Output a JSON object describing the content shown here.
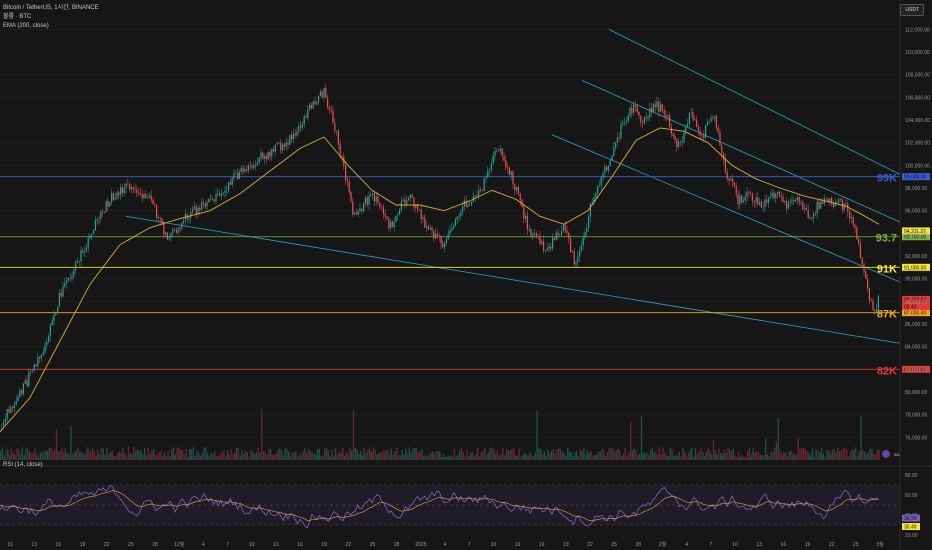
{
  "header": {
    "symbol_line": "Bitcoin / TetherUS, 1시간, BINANCE",
    "volume_label": "볼륨 · BTC",
    "ema_label": "EMA (200, close)",
    "rsi_label": "RSI (14, close)",
    "currency_button": "USDT"
  },
  "chart_data": {
    "type": "candlestick",
    "symbol": "BTC/USDT",
    "interval": "1h",
    "exchange": "BINANCE",
    "ylim": [
      74000,
      113000
    ],
    "y_ticks": [
      76000,
      78000,
      80000,
      82000,
      84000,
      86000,
      88000,
      90000,
      92000,
      94000,
      96000,
      98000,
      100000,
      102000,
      104000,
      106000,
      108000,
      110000,
      112000
    ],
    "y_tick_labels": [
      "76,000.00",
      "78,000.00",
      "80,000.00",
      "82,000.00",
      "84,000.00",
      "86,000.00",
      "88,000.00",
      "90,000.00",
      "92,000.00",
      "94,000.00",
      "96,000.00",
      "98,000.00",
      "100,000.00",
      "102,000.00",
      "104,000.00",
      "106,000.00",
      "108,000.00",
      "110,000.00",
      "112,000.00"
    ],
    "x_tick_labels": [
      "10",
      "13",
      "16",
      "19",
      "22",
      "25",
      "28",
      "12월",
      "4",
      "7",
      "10",
      "13",
      "16",
      "19",
      "22",
      "25",
      "28",
      "2025",
      "4",
      "7",
      "10",
      "13",
      "16",
      "19",
      "22",
      "25",
      "28",
      "2월",
      "4",
      "7",
      "10",
      "13",
      "16",
      "19",
      "22",
      "25",
      "3월"
    ],
    "price_path": [
      {
        "x": 0,
        "y": 77000
      },
      {
        "x": 8,
        "y": 80500
      },
      {
        "x": 14,
        "y": 83500
      },
      {
        "x": 20,
        "y": 88500
      },
      {
        "x": 26,
        "y": 91500
      },
      {
        "x": 32,
        "y": 95000
      },
      {
        "x": 38,
        "y": 97500
      },
      {
        "x": 44,
        "y": 98200
      },
      {
        "x": 50,
        "y": 97000
      },
      {
        "x": 56,
        "y": 93500
      },
      {
        "x": 62,
        "y": 95500
      },
      {
        "x": 68,
        "y": 96500
      },
      {
        "x": 74,
        "y": 97500
      },
      {
        "x": 80,
        "y": 99500
      },
      {
        "x": 86,
        "y": 100500
      },
      {
        "x": 92,
        "y": 101500
      },
      {
        "x": 98,
        "y": 102500
      },
      {
        "x": 104,
        "y": 105500
      },
      {
        "x": 108,
        "y": 106500
      },
      {
        "x": 112,
        "y": 103000
      },
      {
        "x": 118,
        "y": 95500
      },
      {
        "x": 124,
        "y": 97500
      },
      {
        "x": 130,
        "y": 94500
      },
      {
        "x": 136,
        "y": 97500
      },
      {
        "x": 142,
        "y": 94500
      },
      {
        "x": 148,
        "y": 93000
      },
      {
        "x": 154,
        "y": 96500
      },
      {
        "x": 160,
        "y": 97500
      },
      {
        "x": 166,
        "y": 101500
      },
      {
        "x": 170,
        "y": 99500
      },
      {
        "x": 176,
        "y": 94500
      },
      {
        "x": 182,
        "y": 92500
      },
      {
        "x": 188,
        "y": 94500
      },
      {
        "x": 192,
        "y": 91000
      },
      {
        "x": 198,
        "y": 97500
      },
      {
        "x": 204,
        "y": 101000
      },
      {
        "x": 208,
        "y": 104000
      },
      {
        "x": 212,
        "y": 105500
      },
      {
        "x": 214,
        "y": 103500
      },
      {
        "x": 218,
        "y": 105500
      },
      {
        "x": 222,
        "y": 104500
      },
      {
        "x": 226,
        "y": 101500
      },
      {
        "x": 230,
        "y": 104500
      },
      {
        "x": 234,
        "y": 102500
      },
      {
        "x": 238,
        "y": 104500
      },
      {
        "x": 242,
        "y": 99500
      },
      {
        "x": 246,
        "y": 97000
      },
      {
        "x": 250,
        "y": 97500
      },
      {
        "x": 254,
        "y": 96500
      },
      {
        "x": 258,
        "y": 97500
      },
      {
        "x": 262,
        "y": 96500
      },
      {
        "x": 266,
        "y": 97000
      },
      {
        "x": 270,
        "y": 95500
      },
      {
        "x": 274,
        "y": 97000
      },
      {
        "x": 278,
        "y": 96800
      },
      {
        "x": 282,
        "y": 96300
      },
      {
        "x": 285,
        "y": 94500
      },
      {
        "x": 287,
        "y": 91500
      },
      {
        "x": 289,
        "y": 89500
      },
      {
        "x": 291,
        "y": 87000
      },
      {
        "x": 293,
        "y": 88200
      }
    ],
    "ema_200": [
      {
        "x": 0,
        "y": 76500
      },
      {
        "x": 10,
        "y": 79500
      },
      {
        "x": 20,
        "y": 84500
      },
      {
        "x": 30,
        "y": 89500
      },
      {
        "x": 40,
        "y": 93000
      },
      {
        "x": 50,
        "y": 94500
      },
      {
        "x": 60,
        "y": 95300
      },
      {
        "x": 70,
        "y": 96000
      },
      {
        "x": 80,
        "y": 97500
      },
      {
        "x": 90,
        "y": 99500
      },
      {
        "x": 100,
        "y": 101500
      },
      {
        "x": 108,
        "y": 102500
      },
      {
        "x": 116,
        "y": 100000
      },
      {
        "x": 124,
        "y": 97800
      },
      {
        "x": 132,
        "y": 96500
      },
      {
        "x": 140,
        "y": 96500
      },
      {
        "x": 148,
        "y": 96000
      },
      {
        "x": 156,
        "y": 96800
      },
      {
        "x": 164,
        "y": 97800
      },
      {
        "x": 172,
        "y": 97000
      },
      {
        "x": 180,
        "y": 95500
      },
      {
        "x": 188,
        "y": 94800
      },
      {
        "x": 196,
        "y": 96000
      },
      {
        "x": 204,
        "y": 99000
      },
      {
        "x": 212,
        "y": 102200
      },
      {
        "x": 220,
        "y": 103300
      },
      {
        "x": 228,
        "y": 103000
      },
      {
        "x": 236,
        "y": 102000
      },
      {
        "x": 244,
        "y": 100000
      },
      {
        "x": 252,
        "y": 98800
      },
      {
        "x": 260,
        "y": 98000
      },
      {
        "x": 268,
        "y": 97300
      },
      {
        "x": 276,
        "y": 96800
      },
      {
        "x": 282,
        "y": 96400
      },
      {
        "x": 287,
        "y": 95700
      },
      {
        "x": 293,
        "y": 94800
      }
    ],
    "horizontal_levels": [
      {
        "label": "99K",
        "value": 99000,
        "tag": "99,000.00",
        "color": "#3b5bdb"
      },
      {
        "label": "93.7",
        "value": 93700,
        "tag": "93,700.00",
        "color": "#7cb342"
      },
      {
        "label": "91K",
        "value": 91000,
        "tag": "91,000.00",
        "color": "#f5e63a"
      },
      {
        "label": "87K",
        "value": 87000,
        "tag": "87,000.00",
        "color": "#f5a623"
      },
      {
        "label": "82K",
        "value": 82000,
        "tag": "82,000.00",
        "color": "#e53935"
      }
    ],
    "price_tags": [
      {
        "value": 94211.27,
        "text": "94,211.27",
        "color": "#f5e63a"
      },
      {
        "value": 88168.5,
        "text": "88,168.50",
        "color": "#e53935"
      },
      {
        "value": 88168.5,
        "text": "05:40",
        "color": "#e53935"
      }
    ],
    "trend_lines": [
      {
        "name": "channel-top",
        "from": {
          "x": 203,
          "y": 112000
        },
        "to": {
          "x": 300,
          "y": 99200
        }
      },
      {
        "name": "channel-mid-1",
        "from": {
          "x": 194,
          "y": 107500
        },
        "to": {
          "x": 300,
          "y": 95000
        }
      },
      {
        "name": "channel-mid-2",
        "from": {
          "x": 184,
          "y": 102700
        },
        "to": {
          "x": 300,
          "y": 89700
        }
      },
      {
        "name": "long-support",
        "from": {
          "x": 42,
          "y": 95500
        },
        "to": {
          "x": 300,
          "y": 84300
        }
      }
    ],
    "volume": {
      "badge": "566",
      "x_range": [
        0,
        293
      ]
    },
    "rsi": {
      "ylim": [
        15,
        85
      ],
      "y_ticks": [
        20,
        40,
        60,
        80
      ],
      "y_tick_labels": [
        "20.00",
        "40.00",
        "60.00",
        "80.00"
      ],
      "upper_band": 70,
      "lower_band": 30,
      "current": [
        {
          "value": 36.95,
          "text": "36.95",
          "color": "#7e57c2"
        },
        {
          "value": 30.49,
          "text": "30.49",
          "color": "#f5e63a"
        }
      ]
    }
  }
}
